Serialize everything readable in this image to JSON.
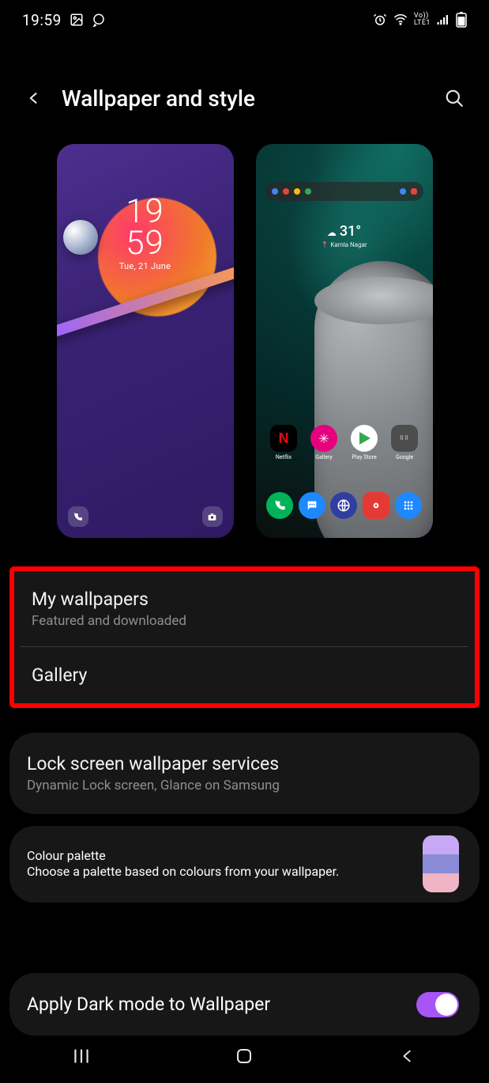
{
  "status_bar": {
    "time": "19:59",
    "indicators": {
      "vo": "Vo))",
      "lte": "LTE1"
    }
  },
  "header": {
    "title": "Wallpaper and style"
  },
  "previews": {
    "lock": {
      "clock_top": "19",
      "clock_bottom": "59",
      "date": "Tue, 21 June"
    },
    "home": {
      "temperature": "31°",
      "location": "Kamla Nagar",
      "apps_row1": [
        {
          "id": "netflix",
          "label": "Netflix"
        },
        {
          "id": "gallery",
          "label": "Gallery"
        },
        {
          "id": "playstore",
          "label": "Play Store"
        },
        {
          "id": "google",
          "label": "Google"
        }
      ],
      "apps_row2": [
        {
          "id": "phone"
        },
        {
          "id": "messages"
        },
        {
          "id": "internet"
        },
        {
          "id": "camera"
        },
        {
          "id": "apps-drawer"
        }
      ]
    }
  },
  "sections": {
    "my_wallpapers": {
      "title": "My wallpapers",
      "subtitle": "Featured and downloaded"
    },
    "gallery": {
      "title": "Gallery"
    },
    "lock_services": {
      "title": "Lock screen wallpaper services",
      "subtitle": "Dynamic Lock screen, Glance on Samsung"
    },
    "palette": {
      "title": "Colour palette",
      "subtitle": "Choose a palette based on colours from your wallpaper."
    },
    "dark_mode": {
      "title": "Apply Dark mode to Wallpaper",
      "enabled": true
    }
  },
  "colors": {
    "highlight_border": "#ff0000",
    "palette_swatch": [
      "#c7a8f5",
      "#8a8cd8",
      "#f1b4c6"
    ],
    "toggle_on": "#a855f7"
  }
}
